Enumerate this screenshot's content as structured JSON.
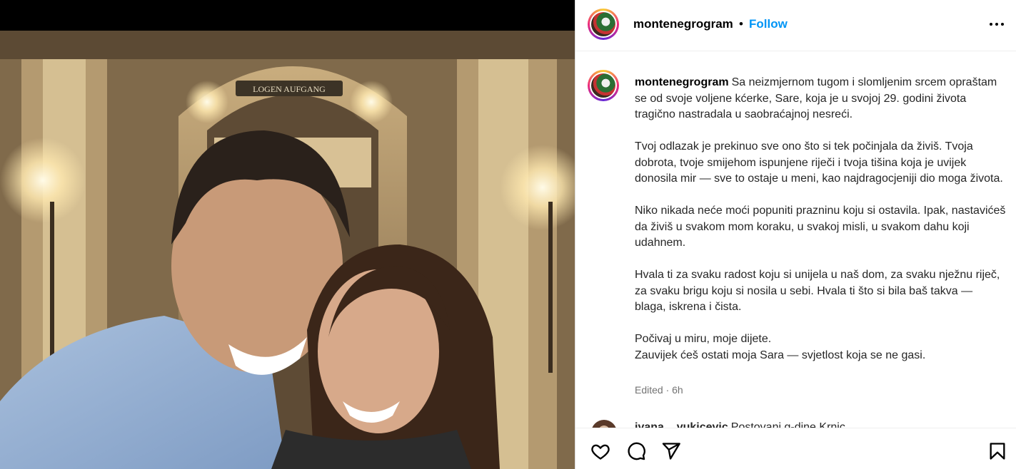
{
  "post": {
    "username": "montenegrogram",
    "separator": "•",
    "follow_label": "Follow",
    "caption": {
      "line1": "Sa neizmjernom tugom i slomljenim srcem opraštam se od svoje voljene kćerke, Sare, koja je u svojoj 29. godini života tragično nastradala u saobraćajnoj nesreći.",
      "p2": "Tvoj odlazak je prekinuo sve ono što si tek počinjala da živiš. Tvoja dobrota, tvoje smijehom ispunjene riječi i tvoja tišina koja je uvijek donosila mir — sve to ostaje u meni, kao najdragocjeniji dio moga života.",
      "p3": "Niko nikada neće moći popuniti prazninu koju si ostavila. Ipak, nastavićeš da živiš u svakom mom koraku, u svakoj misli, u svakom dahu koji udahnem.",
      "p4": "Hvala ti za svaku radost koju si unijela u naš dom, za svaku nježnu riječ, za svaku brigu koju si nosila u sebi. Hvala ti što si bila baš takva — blaga, iskrena i čista.",
      "p5a": "Počivaj u miru, moje dijete.",
      "p5b": "Zauvijek ćeš ostati moja Sara — svjetlost koja se ne gasi."
    },
    "meta": "Edited · 6h",
    "photo_sign": "LOGEN AUFGANG"
  },
  "comment": {
    "username": "ivana__vukicevic",
    "text": "Postovani g-dine Krnic"
  },
  "icons": {
    "more": "more-horizontal-icon",
    "like": "heart-icon",
    "comment": "comment-icon",
    "share": "share-icon",
    "save": "bookmark-icon"
  }
}
